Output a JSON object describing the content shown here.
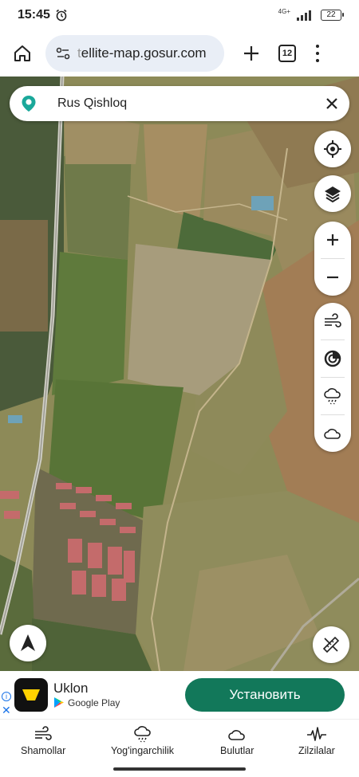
{
  "status_bar": {
    "time": "15:45",
    "network": "4G+",
    "battery": "22"
  },
  "browser": {
    "url_fade": "t",
    "url_text": "ellite-map.gosur.com",
    "tab_count": "12"
  },
  "map": {
    "search_value": "Rus Qishloq",
    "icons": [
      "locate-icon",
      "layers-icon",
      "zoom-in-icon",
      "zoom-out-icon",
      "wind-icon",
      "radar-icon",
      "rain-icon",
      "cloud-icon",
      "compass-icon",
      "ruler-icon"
    ]
  },
  "ad": {
    "app_name": "Uklon",
    "store_name": "Google Play",
    "install_label": "Установить",
    "accent": "#12785a"
  },
  "bottom_nav": {
    "items": [
      {
        "label": "Shamollar",
        "icon": "wind-icon"
      },
      {
        "label": "Yog'ingarchilik",
        "icon": "rain-cloud-icon"
      },
      {
        "label": "Bulutlar",
        "icon": "cloud-icon"
      },
      {
        "label": "Zilzilalar",
        "icon": "seismic-icon"
      }
    ]
  }
}
